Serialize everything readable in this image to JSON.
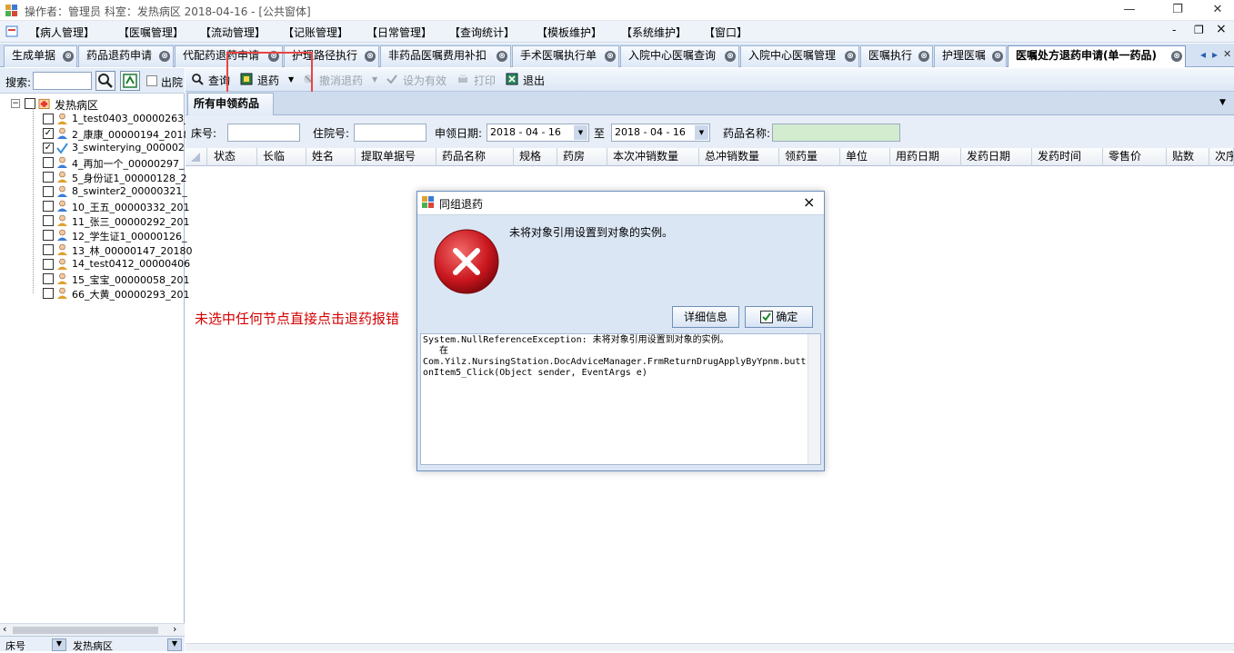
{
  "window": {
    "title": "操作者：管理员  科室：发热病区  2018-04-16 - [公共窗体]",
    "controls": [
      "—",
      "❐",
      "✕"
    ]
  },
  "menu": [
    "【病人管理】",
    "【医嘱管理】",
    "【流动管理】",
    "【记账管理】",
    "【日常管理】",
    "【查询统计】",
    "【模板维护】",
    "【系统维护】",
    "【窗口】"
  ],
  "menu_right": [
    "-",
    "❐",
    "×"
  ],
  "tabs": [
    "生成单据",
    "药品退药申请",
    "代配药退药申请",
    "护理路径执行",
    "非药品医嘱费用补扣",
    "手术医嘱执行单",
    "入院中心医嘱查询",
    "入院中心医嘱管理",
    "医嘱执行",
    "护理医嘱",
    "医嘱处方退药申请(单一药品)"
  ],
  "tab_close": "⊗",
  "tab_nav": [
    "◂",
    "▸",
    "✕"
  ],
  "left_panel": {
    "search_label": "搜索:",
    "discharge_label": "出院",
    "root": "发热病区",
    "patients": [
      {
        "label": "1_test0403_00000263_",
        "checked": false
      },
      {
        "label": "2_康康_00000194_2018",
        "checked": true
      },
      {
        "label": "3_swinterying_000002",
        "checked": true
      },
      {
        "label": "4_再加一个_00000297_",
        "checked": false
      },
      {
        "label": "5_身份证1_00000128_2",
        "checked": false
      },
      {
        "label": "8_swinter2_00000321_",
        "checked": false
      },
      {
        "label": "10_王五_00000332_201",
        "checked": false
      },
      {
        "label": "11_张三_00000292_201",
        "checked": false
      },
      {
        "label": "12_学生证1_00000126_",
        "checked": false
      },
      {
        "label": "13_林_00000147_20180",
        "checked": false
      },
      {
        "label": "14_test0412_00000406",
        "checked": false
      },
      {
        "label": "15_宝宝_00000058_201",
        "checked": false
      },
      {
        "label": "66_大黄_00000293_201",
        "checked": false
      }
    ],
    "bottom_left": "床号",
    "bottom_right": "发热病区"
  },
  "toolbar": {
    "query": "查询",
    "return": "退药",
    "cancel_return": "撤消退药",
    "set_valid": "设为有效",
    "print": "打印",
    "exit": "退出"
  },
  "subtab": "所有申领药品",
  "filter": {
    "bed_label": "床号:",
    "inpatient_label": "住院号:",
    "date_label": "申领日期:",
    "date_from": "2018 - 04 - 16",
    "to_label": "至",
    "date_to": "2018 - 04 - 16",
    "drug_label": "药品名称:"
  },
  "grid_columns": [
    "状态",
    "长临",
    "姓名",
    "提取单据号",
    "药品名称",
    "规格",
    "药房",
    "本次冲销数量",
    "总冲销数量",
    "领药量",
    "单位",
    "用药日期",
    "发药日期",
    "发药时间",
    "零售价",
    "贴数",
    "次序"
  ],
  "dialog": {
    "title": "同组退药",
    "message": "未将对象引用设置到对象的实例。",
    "details_button": "详细信息",
    "ok_button": "确定",
    "detail_lines": [
      "System.NullReferenceException: 未将对象引用设置到对象的实例。",
      "   在",
      "Com.Yilz.NursingStation.DocAdviceManager.FrmReturnDrugApplyByYpnm.butt",
      "onItem5_Click(Object sender, EventArgs e)"
    ]
  },
  "annotation": "未选中任何节点直接点击退药报错",
  "colors": {
    "annotation_red": "#d40000",
    "error_red": "#c8161d",
    "tab_bg": "#d5e2f3"
  }
}
